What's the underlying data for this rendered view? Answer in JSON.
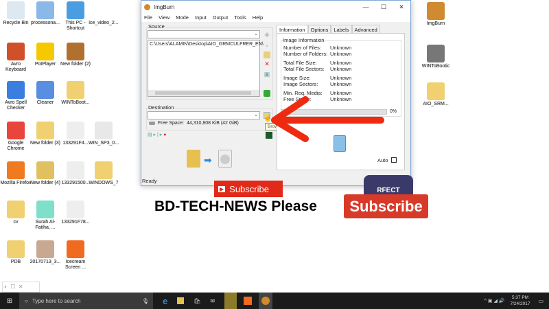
{
  "desktop": {
    "icons": [
      {
        "label": "Recycle Bin",
        "color": "#dde8f0"
      },
      {
        "label": "processona...",
        "color": "#8ab8e8"
      },
      {
        "label": "This PC - Shortcut",
        "color": "#4a9de0"
      },
      {
        "label": "ice_video_2...",
        "color": "#ffffff"
      },
      {
        "label": "Avro Keyboard",
        "color": "#d0502a"
      },
      {
        "label": "PotPlayer",
        "color": "#f5c800"
      },
      {
        "label": "New folder (2)",
        "color": "#b07030"
      },
      {
        "label": "Avro Spell Checker",
        "color": "#3a7ee0"
      },
      {
        "label": "Cleaner",
        "color": "#5a8ee0"
      },
      {
        "label": "WINToBoot...",
        "color": "#f0d070"
      },
      {
        "label": "Google Chrome",
        "color": "#e8453c"
      },
      {
        "label": "New folder (3)",
        "color": "#f0d070"
      },
      {
        "label": "133291F4...",
        "color": "#eeeeee"
      },
      {
        "label": "WIN_SP3_0...",
        "color": "#e8e8e8"
      },
      {
        "label": "Mozilla Firefox",
        "color": "#f07a20"
      },
      {
        "label": "New folder (4)",
        "color": "#e0c060"
      },
      {
        "label": "133291500...",
        "color": "#eeeeee"
      },
      {
        "label": "WINDOWS_7",
        "color": "#f0d070"
      },
      {
        "label": "cv",
        "color": "#f0d070"
      },
      {
        "label": "Surah Al-Fatiha, ...",
        "color": "#7ee0c8"
      },
      {
        "label": "133291F78...",
        "color": "#eeeeee"
      },
      {
        "label": "PDB",
        "color": "#f0d070"
      },
      {
        "label": "20170713_3...",
        "color": "#c8a890"
      },
      {
        "label": "Icecream Screen ...",
        "color": "#f06a20"
      }
    ],
    "right_icons": [
      {
        "label": "ImgBurn",
        "color": "#d08a30"
      },
      {
        "label": "WINToBootic",
        "color": "#777777"
      },
      {
        "label": "AIO_SRM...",
        "color": "#f0d070"
      }
    ]
  },
  "window": {
    "title": "ImgBurn",
    "menu": [
      "File",
      "View",
      "Mode",
      "Input",
      "Output",
      "Tools",
      "Help"
    ],
    "source_label": "Source",
    "source_item": "C:\\Users\\ALAMIN\\Desktop\\AIO_GRMCULFRER_EN\\",
    "destination_label": "Destination",
    "free_space_label": "Free Space:",
    "free_space_value": "44,310,808 KiB  (42 GiB)",
    "tooltip": "Browse for a file...",
    "tabs": [
      "Information",
      "Options",
      "Labels",
      "Advanced"
    ],
    "info_group": "Image Information",
    "info": [
      {
        "k": "Number of Files:",
        "v": "Unknown"
      },
      {
        "k": "Number of Folders:",
        "v": "Unknown"
      },
      {
        "k": "Total File Size:",
        "v": "Unknown"
      },
      {
        "k": "Total File Sectors:",
        "v": "Unknown"
      },
      {
        "k": "Image Size:",
        "v": "Unknown"
      },
      {
        "k": "Image Sectors:",
        "v": "Unknown"
      },
      {
        "k": "Min. Req. Media:",
        "v": "Unknown"
      },
      {
        "k": "Free Space:",
        "v": "Unknown"
      }
    ],
    "progress_text": "0%",
    "progress": 0,
    "auto_label": "Auto",
    "status": "Ready"
  },
  "overlay": {
    "small_subscribe": "Subscribe",
    "banner_left": "BD-TECH-NEWS Please",
    "banner_btn": "Subscribe",
    "shirt_text": "RFECT",
    "arrow_color": "#ee2a10"
  },
  "taskbar": {
    "search_placeholder": "Type here to search",
    "time": "5:37 PM",
    "date": "7/24/2017"
  }
}
